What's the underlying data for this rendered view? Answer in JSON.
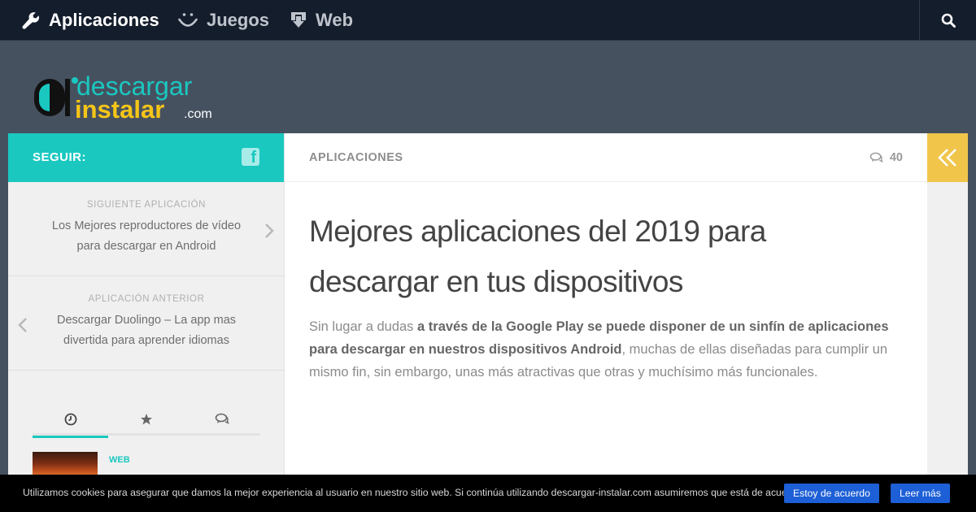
{
  "nav": {
    "items": [
      {
        "label": "Aplicaciones",
        "icon": "wrench-icon",
        "active": true
      },
      {
        "label": "Juegos",
        "icon": "smile-icon",
        "active": false
      },
      {
        "label": "Web",
        "icon": "download-icon",
        "active": false
      }
    ],
    "search_icon": "search-icon"
  },
  "logo": {
    "line1": "descargar",
    "line2": "instalar",
    "suffix": ".com"
  },
  "sidebar": {
    "follow_label": "SEGUIR:",
    "facebook_letter": "f",
    "next": {
      "kicker": "SIGUIENTE APLICACIÓN",
      "title": "Los Mejores reproductores de vídeo para descargar en Android"
    },
    "prev": {
      "kicker": "APLICACIÓN ANTERIOR",
      "title": "Descargar Duolingo – La app mas divertida para aprender idiomas"
    },
    "tabs": [
      {
        "icon": "clock-icon",
        "active": true
      },
      {
        "icon": "star-icon",
        "active": false
      },
      {
        "icon": "comments-icon",
        "active": false
      }
    ],
    "widget_item": {
      "category": "WEB"
    }
  },
  "main": {
    "category": "APLICACIONES",
    "comment_count": "40",
    "title": "Mejores aplicaciones del 2019 para descargar en tus dispositivos",
    "intro_plain": "Sin lugar a dudas ",
    "intro_bold": "a través de la Google Play se puede disponer de un sinfín de aplicaciones para descargar en nuestros dispositivos Android",
    "intro_rest": ", muchas de ellas diseñadas para cumplir un mismo fin, sin embargo, unas más atractivas que otras y muchísimo más funcionales."
  },
  "cookie": {
    "text": "Utilizamos cookies para asegurar que damos la mejor experiencia al usuario en nuestro sitio web. Si continúa utilizando descargar-instalar.com asumiremos que está de acuerdo.",
    "agree_label": "Estoy de acuerdo",
    "more_label": "Leer más"
  },
  "colors": {
    "accent": "#1ac8c0",
    "collapse": "#f0c54a",
    "nav_bg": "#141d2c",
    "header_bg": "#465160",
    "cookie_button": "#1d5fd6"
  }
}
